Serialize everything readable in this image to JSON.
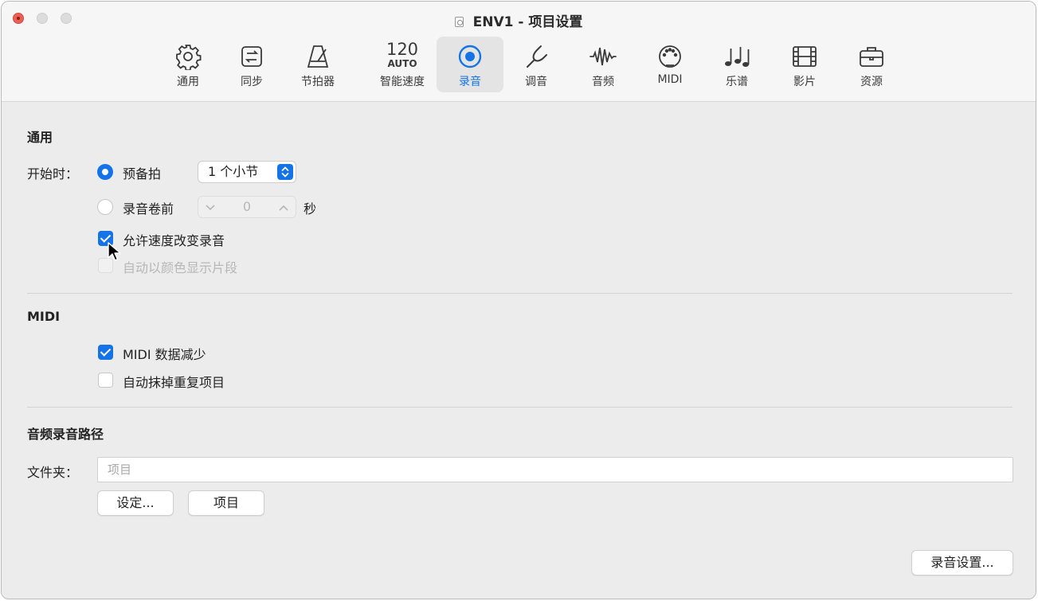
{
  "window": {
    "title": "ENV1 - 项目设置"
  },
  "tabs": [
    {
      "label": "通用",
      "icon": "gear-icon"
    },
    {
      "label": "同步",
      "icon": "sync-icon"
    },
    {
      "label": "节拍器",
      "icon": "metronome-icon"
    },
    {
      "label": "智能速度",
      "icon": "tempo-icon",
      "number": "120",
      "sub": "AUTO"
    },
    {
      "label": "录音",
      "icon": "record-icon",
      "active": true
    },
    {
      "label": "调音",
      "icon": "tuning-fork-icon"
    },
    {
      "label": "音频",
      "icon": "waveform-icon"
    },
    {
      "label": "MIDI",
      "icon": "midi-port-icon"
    },
    {
      "label": "乐谱",
      "icon": "music-notes-icon"
    },
    {
      "label": "影片",
      "icon": "film-icon"
    },
    {
      "label": "资源",
      "icon": "briefcase-icon"
    }
  ],
  "general": {
    "heading": "通用",
    "start_label": "开始时：",
    "count_in_label": "预备拍",
    "count_in_value": "1 个小节",
    "preroll_label": "录音卷前",
    "preroll_value": "0",
    "preroll_unit": "秒",
    "allow_tempo_label": "允许速度改变录音",
    "allow_tempo_checked": true,
    "auto_color_label": "自动以颜色显示片段",
    "auto_color_checked": false
  },
  "midi": {
    "heading": "MIDI",
    "reduce_label": "MIDI 数据减少",
    "reduce_checked": true,
    "auto_demix_label": "自动抹掉重复项目",
    "auto_demix_checked": false
  },
  "audio_path": {
    "heading": "音频录音路径",
    "folder_label": "文件夹：",
    "folder_placeholder": "项目",
    "set_button": "设定...",
    "project_button": "项目"
  },
  "footer": {
    "recording_settings_button": "录音设置..."
  },
  "colors": {
    "accent": "#1473e6",
    "close": "#ec5f57"
  }
}
